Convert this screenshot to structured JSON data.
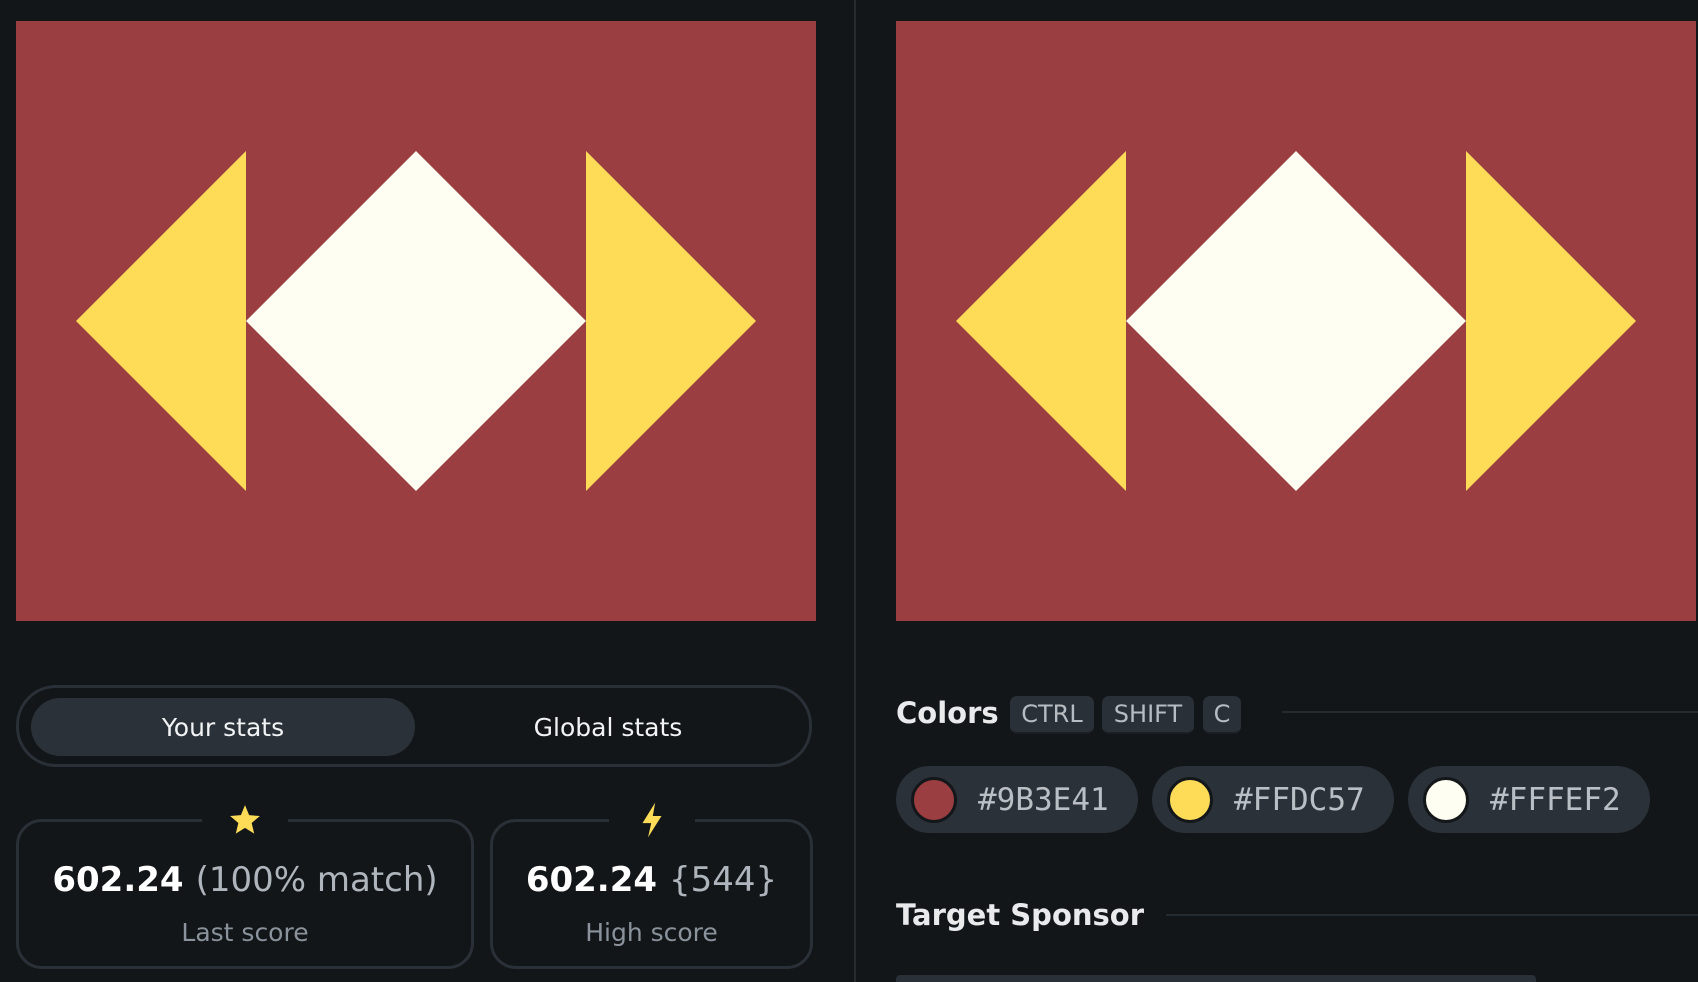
{
  "colors": {
    "background": "#131619",
    "canvas_red": "#9B3E41",
    "canvas_yellow": "#FFDC57",
    "canvas_cream": "#FFFEF2",
    "star": "#FFDC57"
  },
  "stats": {
    "tabs": [
      {
        "label": "Your stats",
        "active": true
      },
      {
        "label": "Global stats",
        "active": false
      }
    ],
    "last_score": {
      "icon": "star-icon",
      "value": "602.24",
      "detail": "(100% match)",
      "label": "Last score"
    },
    "high_score": {
      "icon": "lightning-icon",
      "value": "602.24",
      "detail": "{544}",
      "label": "High score"
    }
  },
  "palette": {
    "title": "Colors",
    "shortcut": [
      "CTRL",
      "SHIFT",
      "C"
    ],
    "swatches": [
      {
        "hex": "#9B3E41",
        "label": "#9B3E41"
      },
      {
        "hex": "#FFDC57",
        "label": "#FFDC57"
      },
      {
        "hex": "#FFFEF2",
        "label": "#FFFEF2"
      }
    ]
  },
  "sponsor": {
    "title": "Target Sponsor"
  }
}
